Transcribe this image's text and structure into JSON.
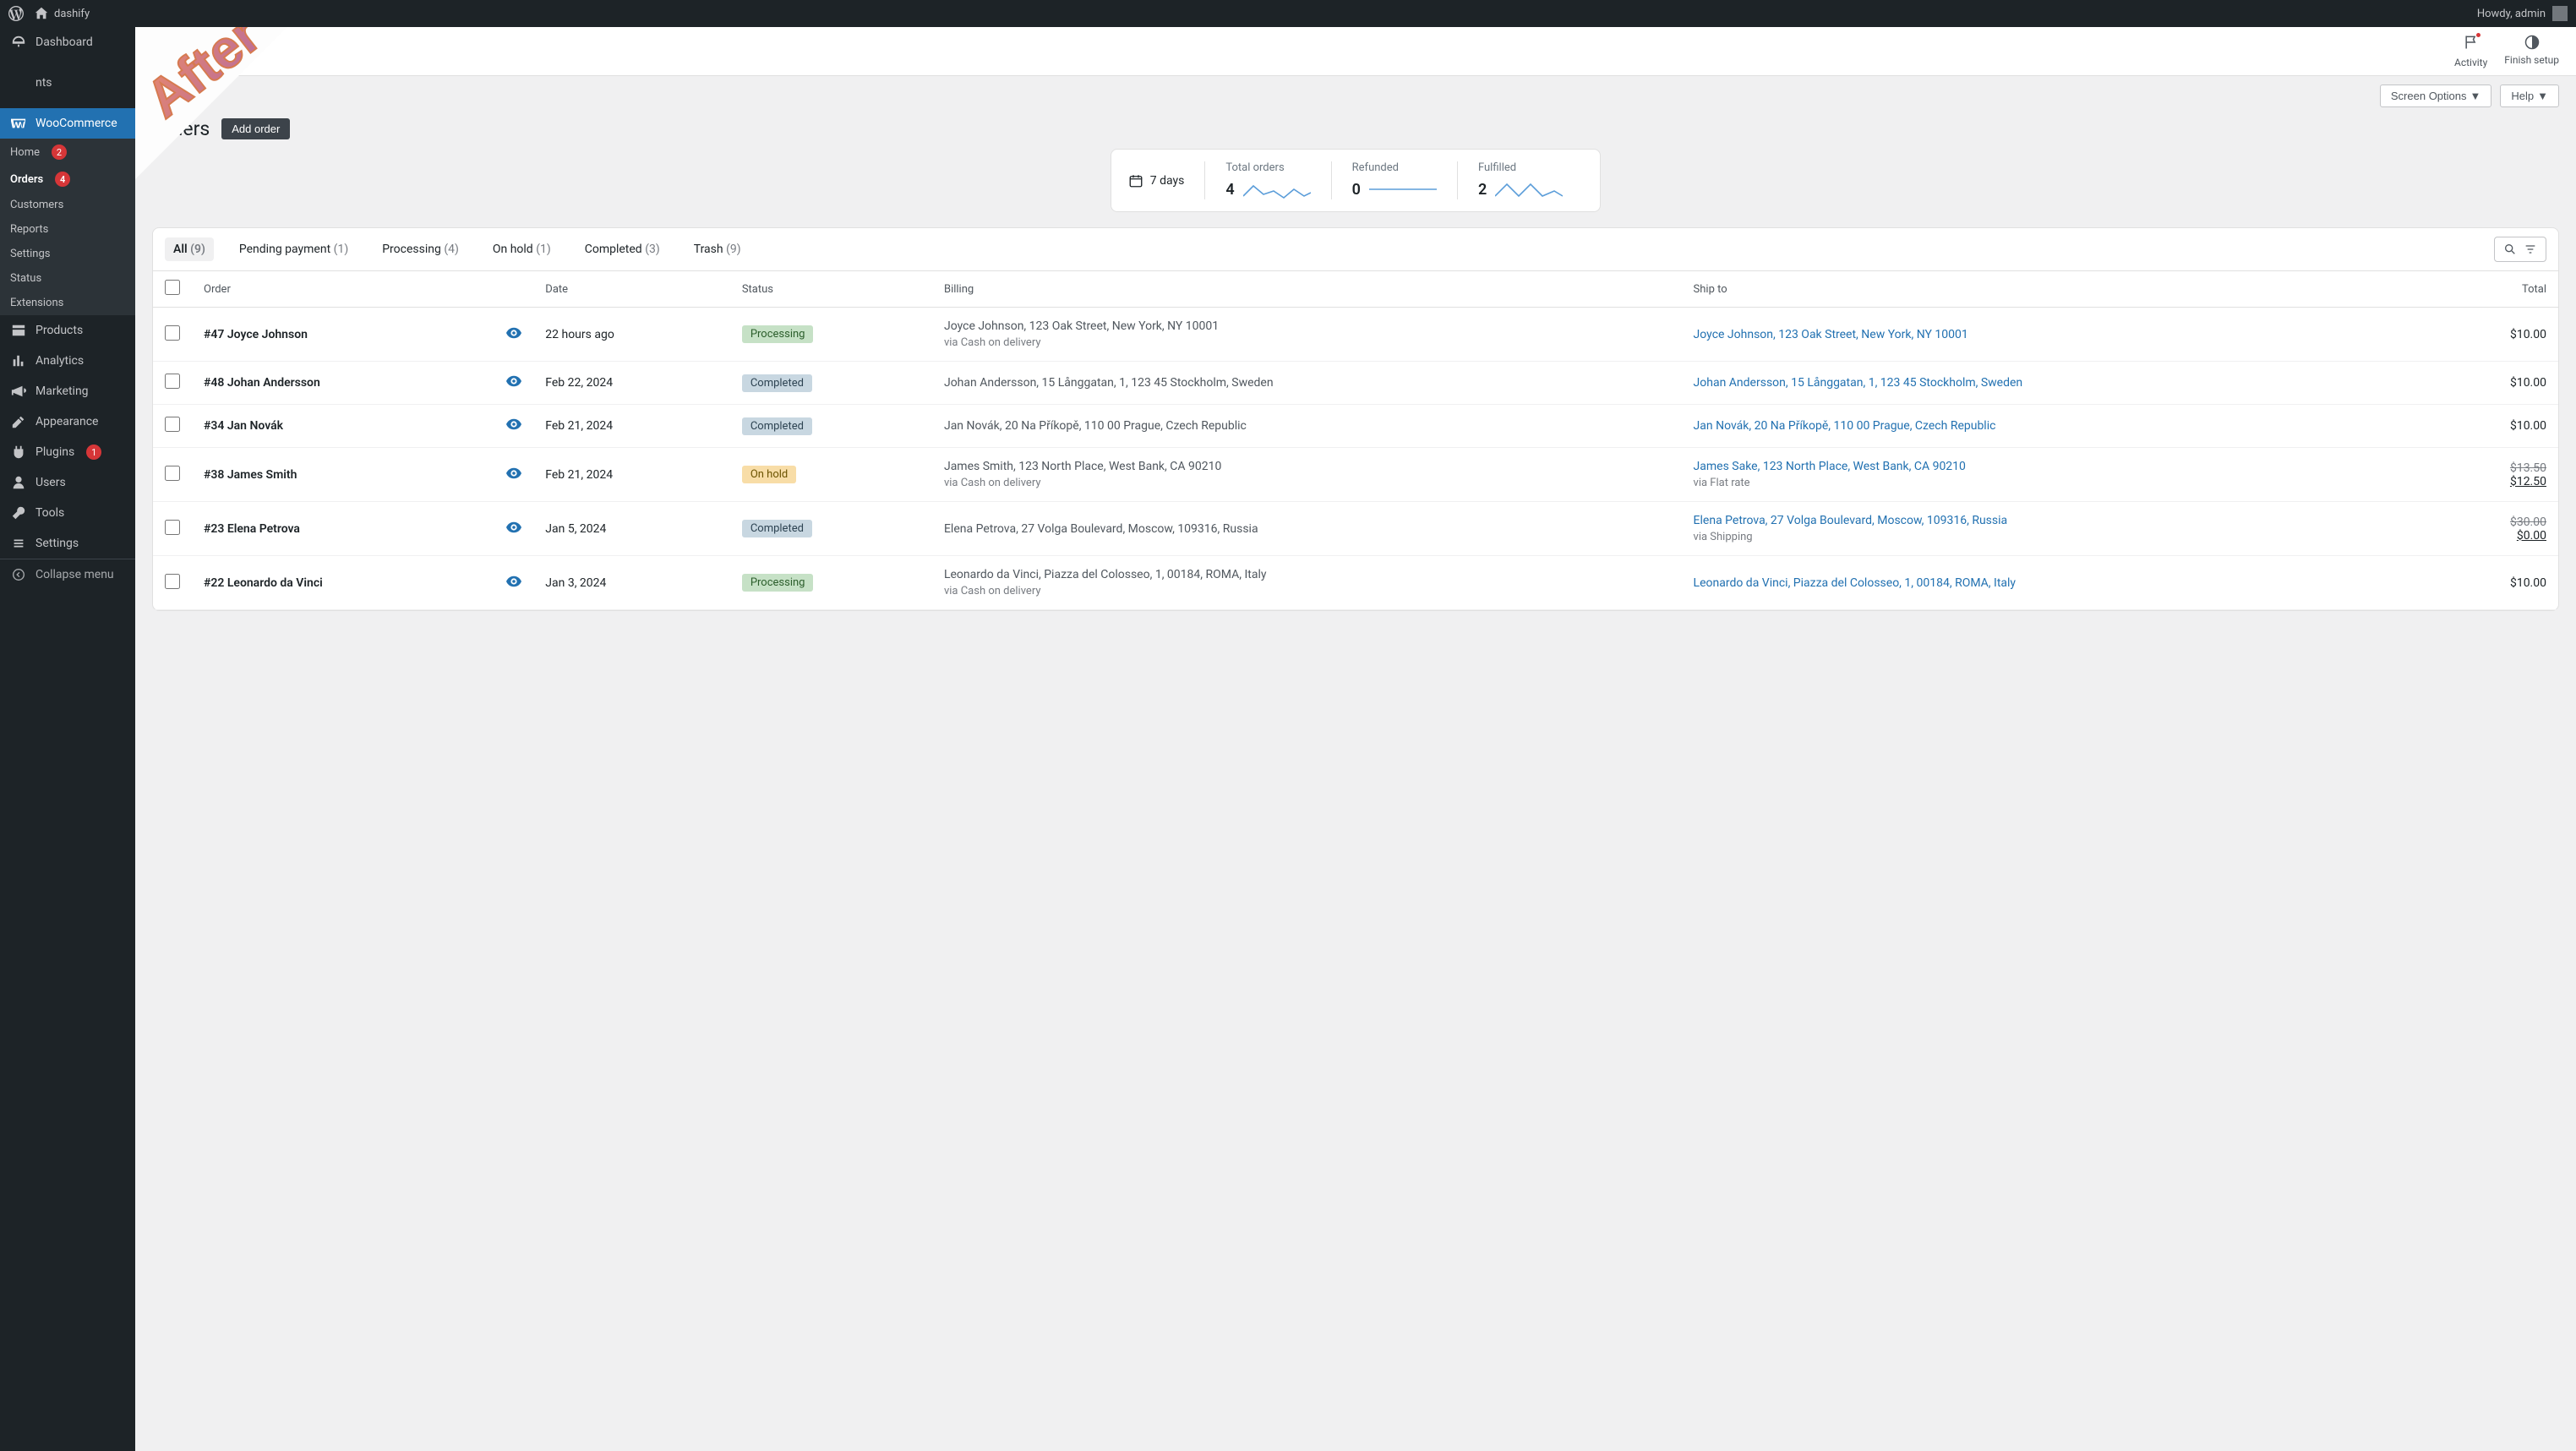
{
  "topbar": {
    "site": "dashify",
    "howdy": "Howdy, admin"
  },
  "actionbar": {
    "activity": "Activity",
    "finish": "Finish setup"
  },
  "options": {
    "screen": "Screen Options",
    "help": "Help"
  },
  "page": {
    "title": "Orders",
    "add": "Add order"
  },
  "sidebar": {
    "dashboard": "Dashboard",
    "wc": "WooCommerce",
    "sub": {
      "home": "Home",
      "home_count": "2",
      "orders": "Orders",
      "orders_count": "4",
      "customers": "Customers",
      "reports": "Reports",
      "settings": "Settings",
      "status": "Status",
      "extensions": "Extensions"
    },
    "products": "Products",
    "analytics": "Analytics",
    "marketing": "Marketing",
    "appearance": "Appearance",
    "plugins": "Plugins",
    "plugins_count": "1",
    "users": "Users",
    "tools": "Tools",
    "settings_main": "Settings",
    "collapse": "Collapse menu"
  },
  "stats": {
    "period": "7 days",
    "total_label": "Total orders",
    "total_val": "4",
    "refunded_label": "Refunded",
    "refunded_val": "0",
    "fulfilled_label": "Fulfilled",
    "fulfilled_val": "2"
  },
  "tabs": {
    "all": "All",
    "all_c": "(9)",
    "pending": "Pending payment",
    "pending_c": "(1)",
    "processing": "Processing",
    "processing_c": "(4)",
    "onhold": "On hold",
    "onhold_c": "(1)",
    "completed": "Completed",
    "completed_c": "(3)",
    "trash": "Trash",
    "trash_c": "(9)"
  },
  "headers": {
    "order": "Order",
    "date": "Date",
    "status": "Status",
    "billing": "Billing",
    "ship": "Ship to",
    "total": "Total"
  },
  "rows": [
    {
      "order": "#47 Joyce Johnson",
      "date": "22 hours ago",
      "status": "Processing",
      "status_cls": "processing",
      "billing": "Joyce Johnson, 123 Oak Street, New York, NY 10001",
      "via": "via Cash on delivery",
      "ship": "Joyce Johnson, 123 Oak Street, New York, NY 10001",
      "ship_via": "",
      "total": "$10.00",
      "strike": ""
    },
    {
      "order": "#48 Johan Andersson",
      "date": "Feb 22, 2024",
      "status": "Completed",
      "status_cls": "completed",
      "billing": "Johan Andersson, 15 Långgatan, 1, 123 45 Stockholm, Sweden",
      "via": "",
      "ship": "Johan Andersson, 15 Långgatan, 1, 123 45 Stockholm, Sweden",
      "ship_via": "",
      "total": "$10.00",
      "strike": ""
    },
    {
      "order": "#34 Jan Novák",
      "date": "Feb 21, 2024",
      "status": "Completed",
      "status_cls": "completed",
      "billing": "Jan Novák, 20 Na Příkopě, 110 00 Prague, Czech Republic",
      "via": "",
      "ship": "Jan Novák, 20 Na Příkopě, 110 00 Prague, Czech Republic",
      "ship_via": "",
      "total": "$10.00",
      "strike": ""
    },
    {
      "order": "#38 James Smith",
      "date": "Feb 21, 2024",
      "status": "On hold",
      "status_cls": "onhold",
      "billing": "James Smith, 123 North Place, West Bank, CA 90210",
      "via": "via Cash on delivery",
      "ship": "James Sake, 123 North Place, West Bank, CA 90210",
      "ship_via": "via Flat rate",
      "total": "$12.50",
      "strike": "$13.50"
    },
    {
      "order": "#23 Elena Petrova",
      "date": "Jan 5, 2024",
      "status": "Completed",
      "status_cls": "completed",
      "billing": "Elena Petrova, 27 Volga Boulevard, Moscow, 109316, Russia",
      "via": "",
      "ship": "Elena Petrova, 27 Volga Boulevard, Moscow, 109316, Russia",
      "ship_via": "via Shipping",
      "total": "$0.00",
      "strike": "$30.00"
    },
    {
      "order": "#22 Leonardo da Vinci",
      "date": "Jan 3, 2024",
      "status": "Processing",
      "status_cls": "processing",
      "billing": "Leonardo da Vinci, Piazza del Colosseo, 1, 00184, ROMA, Italy",
      "via": "via Cash on delivery",
      "ship": "Leonardo da Vinci, Piazza del Colosseo, 1, 00184, ROMA, Italy",
      "ship_via": "",
      "total": "$10.00",
      "strike": ""
    }
  ],
  "ribbon": "After"
}
